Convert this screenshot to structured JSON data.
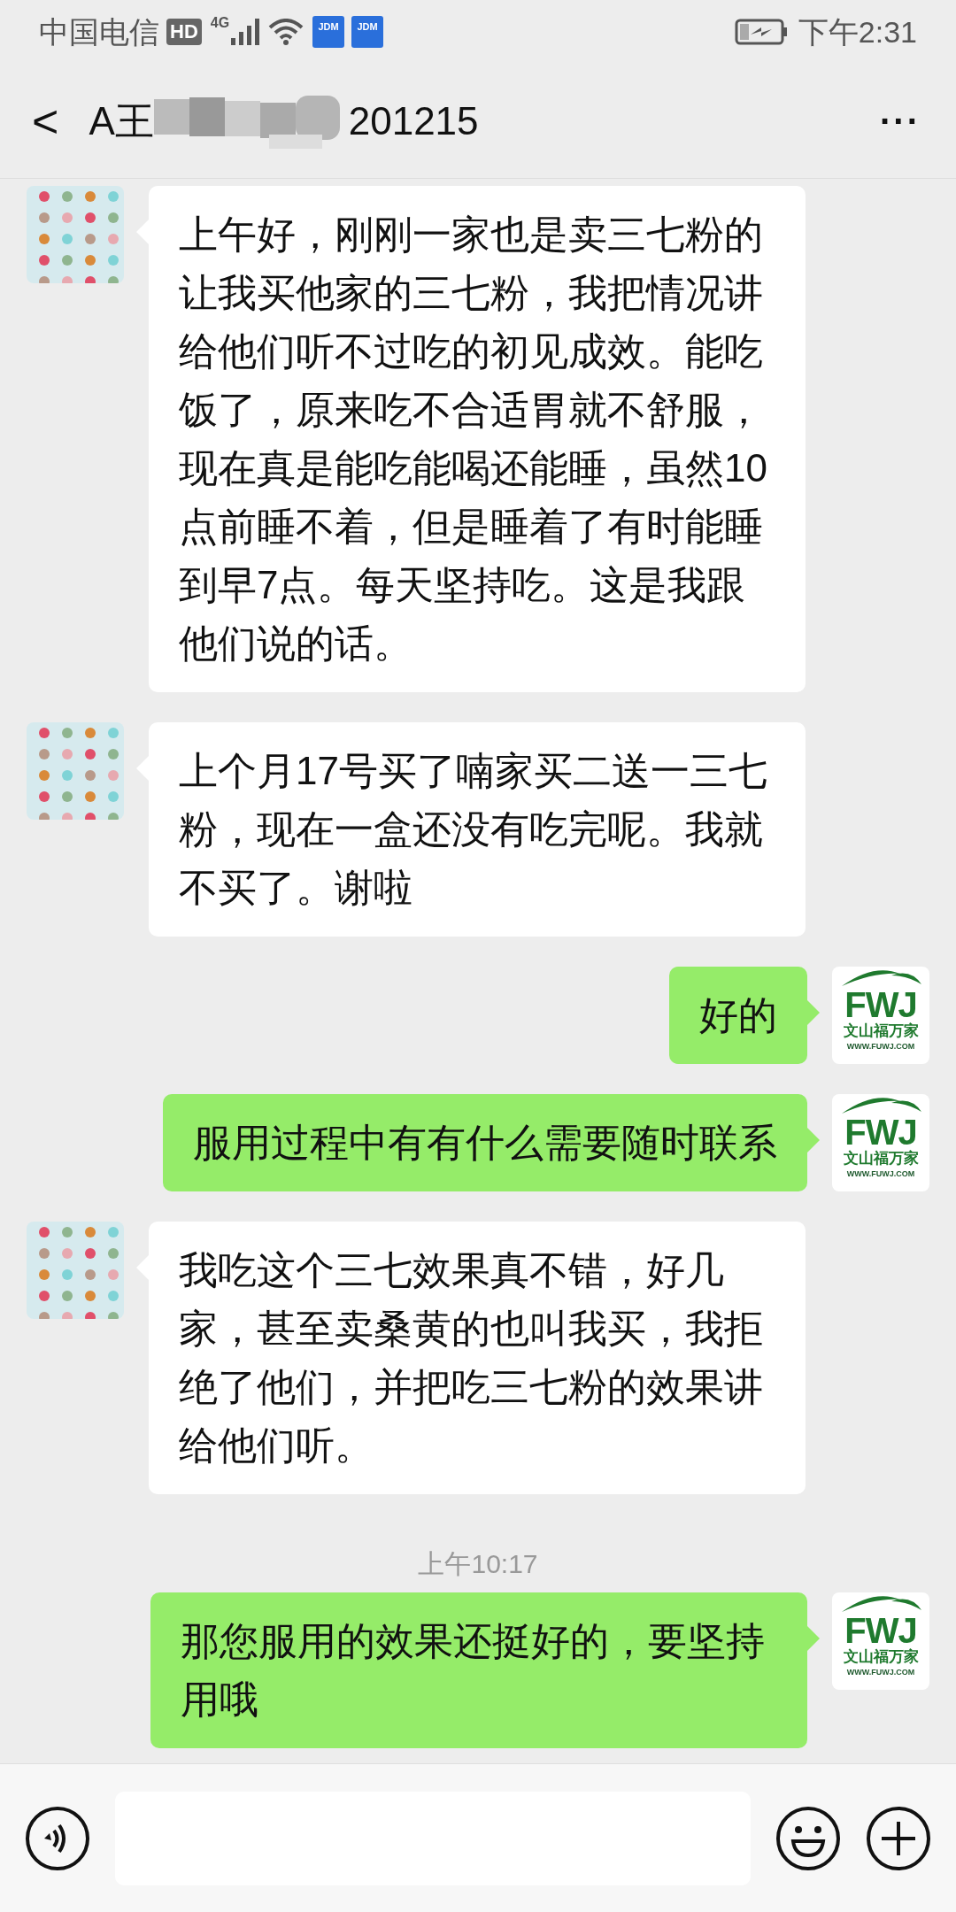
{
  "status_bar": {
    "carrier": "中国电信",
    "hd": "HD",
    "network": "4G",
    "app_badges": [
      "JDM",
      "JDM"
    ],
    "time": "下午2:31"
  },
  "header": {
    "back": "<",
    "title_start": "A王",
    "title_end": "201215",
    "more": "···"
  },
  "messages": [
    {
      "kind": "incoming",
      "text": "上午好，刚刚一家也是卖三七粉的让我买他家的三七粉，我把情况讲给他们听不过吃的初见成效。能吃饭了，原来吃不合适胃就不舒服，现在真是能吃能喝还能睡，虽然10点前睡不着，但是睡着了有时能睡到早7点。每天坚持吃。这是我跟他们说的话。"
    },
    {
      "kind": "incoming",
      "text": "上个月17号买了喃家买二送一三七粉，现在一盒还没有吃完呢。我就不买了。谢啦"
    },
    {
      "kind": "outgoing",
      "text": "好的",
      "logo": {
        "mark": "FWJ",
        "name": "文山福万家",
        "url": "WWW.FUWJ.COM"
      }
    },
    {
      "kind": "outgoing",
      "text": "服用过程中有有什么需要随时联系",
      "logo": {
        "mark": "FWJ",
        "name": "文山福万家",
        "url": "WWW.FUWJ.COM"
      }
    },
    {
      "kind": "incoming",
      "text": "我吃这个三七效果真不错，好几家，甚至卖桑黄的也叫我买，我拒绝了他们，并把吃三七粉的效果讲给他们听。"
    },
    {
      "kind": "time",
      "text": "上午10:17"
    },
    {
      "kind": "outgoing",
      "text": "那您服用的效果还挺好的，要坚持用哦",
      "logo": {
        "mark": "FWJ",
        "name": "文山福万家",
        "url": "WWW.FUWJ.COM"
      }
    }
  ]
}
